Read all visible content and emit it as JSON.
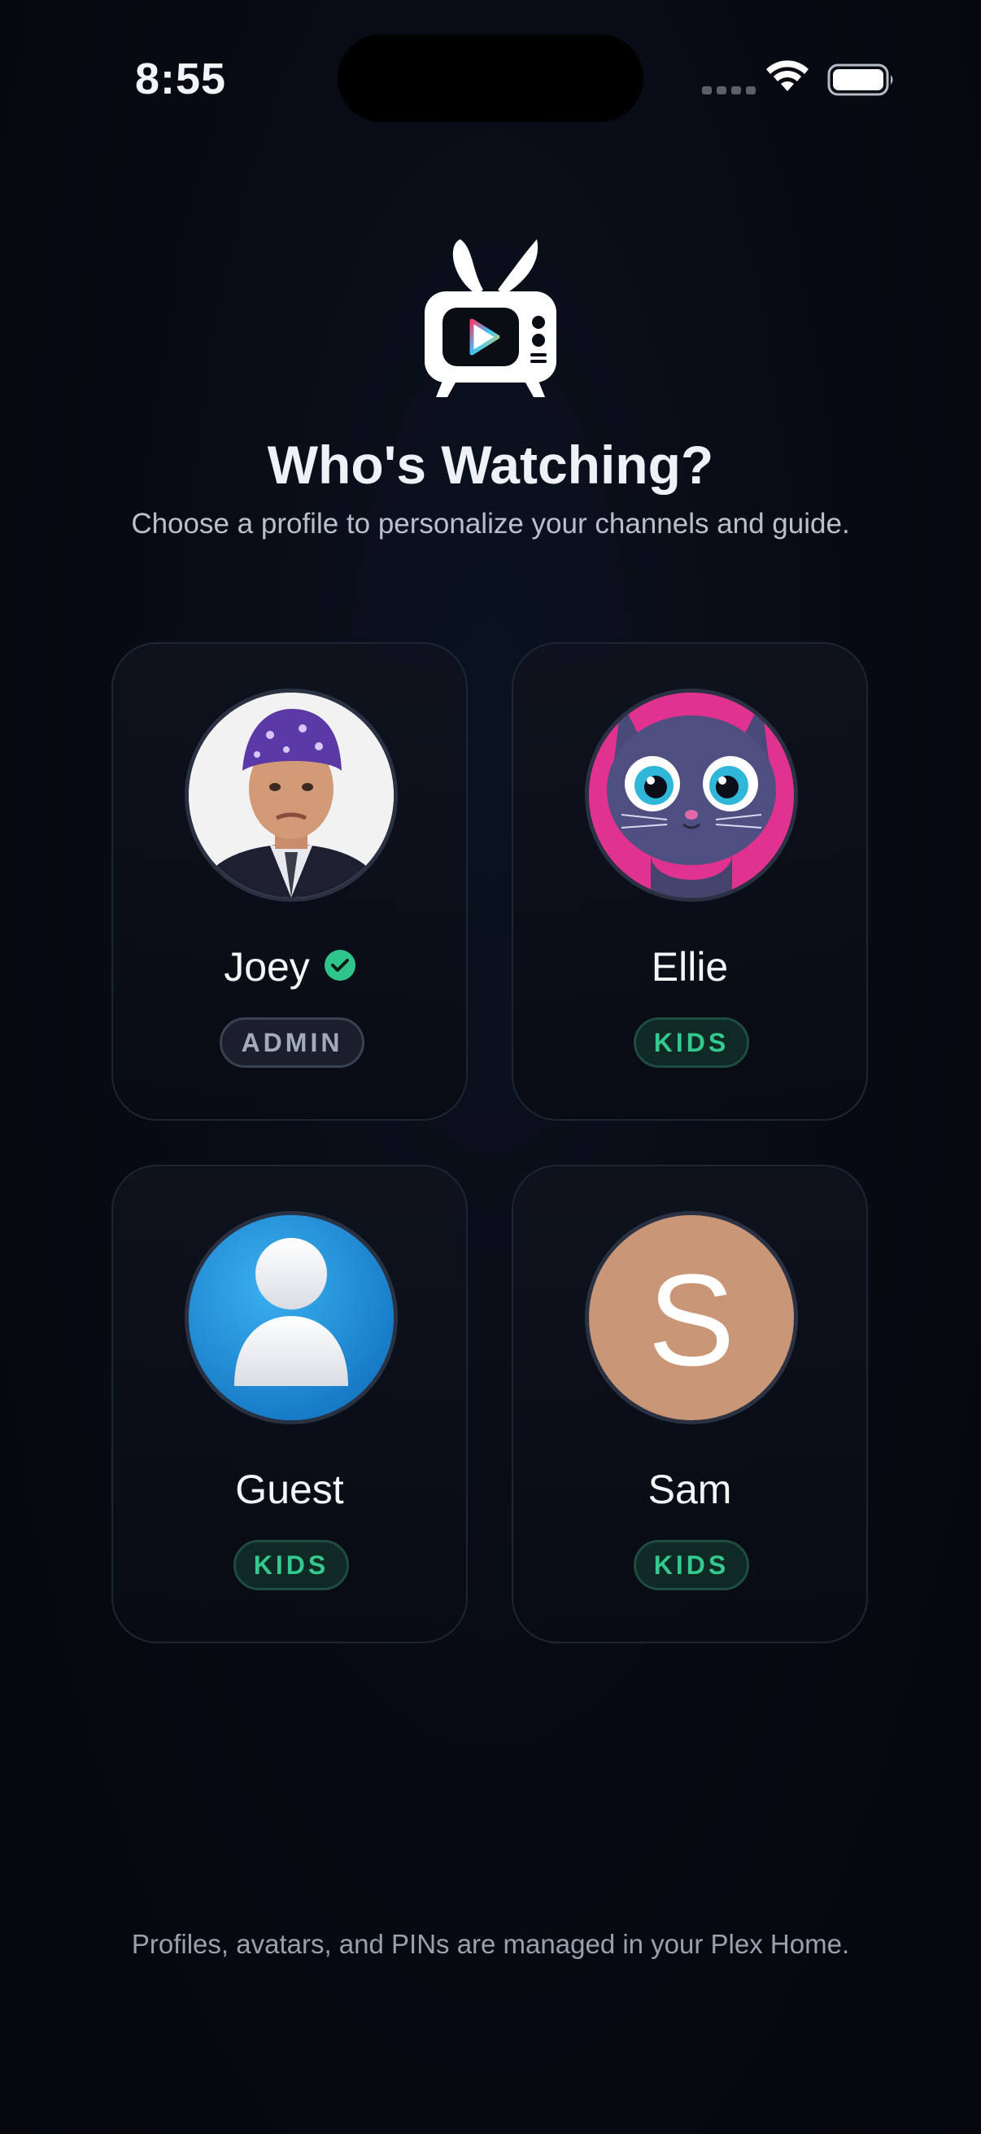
{
  "status_bar": {
    "time": "8:55",
    "icons": [
      "signal-icon",
      "wifi-icon",
      "battery-icon"
    ]
  },
  "header": {
    "logo": "tv-play-logo-icon",
    "title": "Who's Watching?",
    "subtitle": "Choose a profile to personalize your channels and guide."
  },
  "profiles": [
    {
      "name": "Joey",
      "badge": "ADMIN",
      "verified": true,
      "avatar": "photo-avatar"
    },
    {
      "name": "Ellie",
      "badge": "KIDS",
      "avatar": "cartoon-cat-avatar"
    },
    {
      "name": "Guest",
      "badge": "KIDS",
      "avatar": "person-silhouette-icon"
    },
    {
      "name": "Sam",
      "badge": "KIDS",
      "avatar": "initial-avatar",
      "initial": "S"
    }
  ],
  "footer": {
    "note": "Profiles, avatars, and PINs are managed in your Plex Home."
  },
  "colors": {
    "background": "#070a12",
    "card_border": "#1e2534",
    "kids_badge_text": "#34c98e",
    "admin_badge_text": "#a4abb8",
    "verified_check": "#2fc58a",
    "guest_avatar": "#1e8fd8",
    "sam_avatar": "#c99677",
    "ellie_avatar_bg": "#e0338f"
  }
}
